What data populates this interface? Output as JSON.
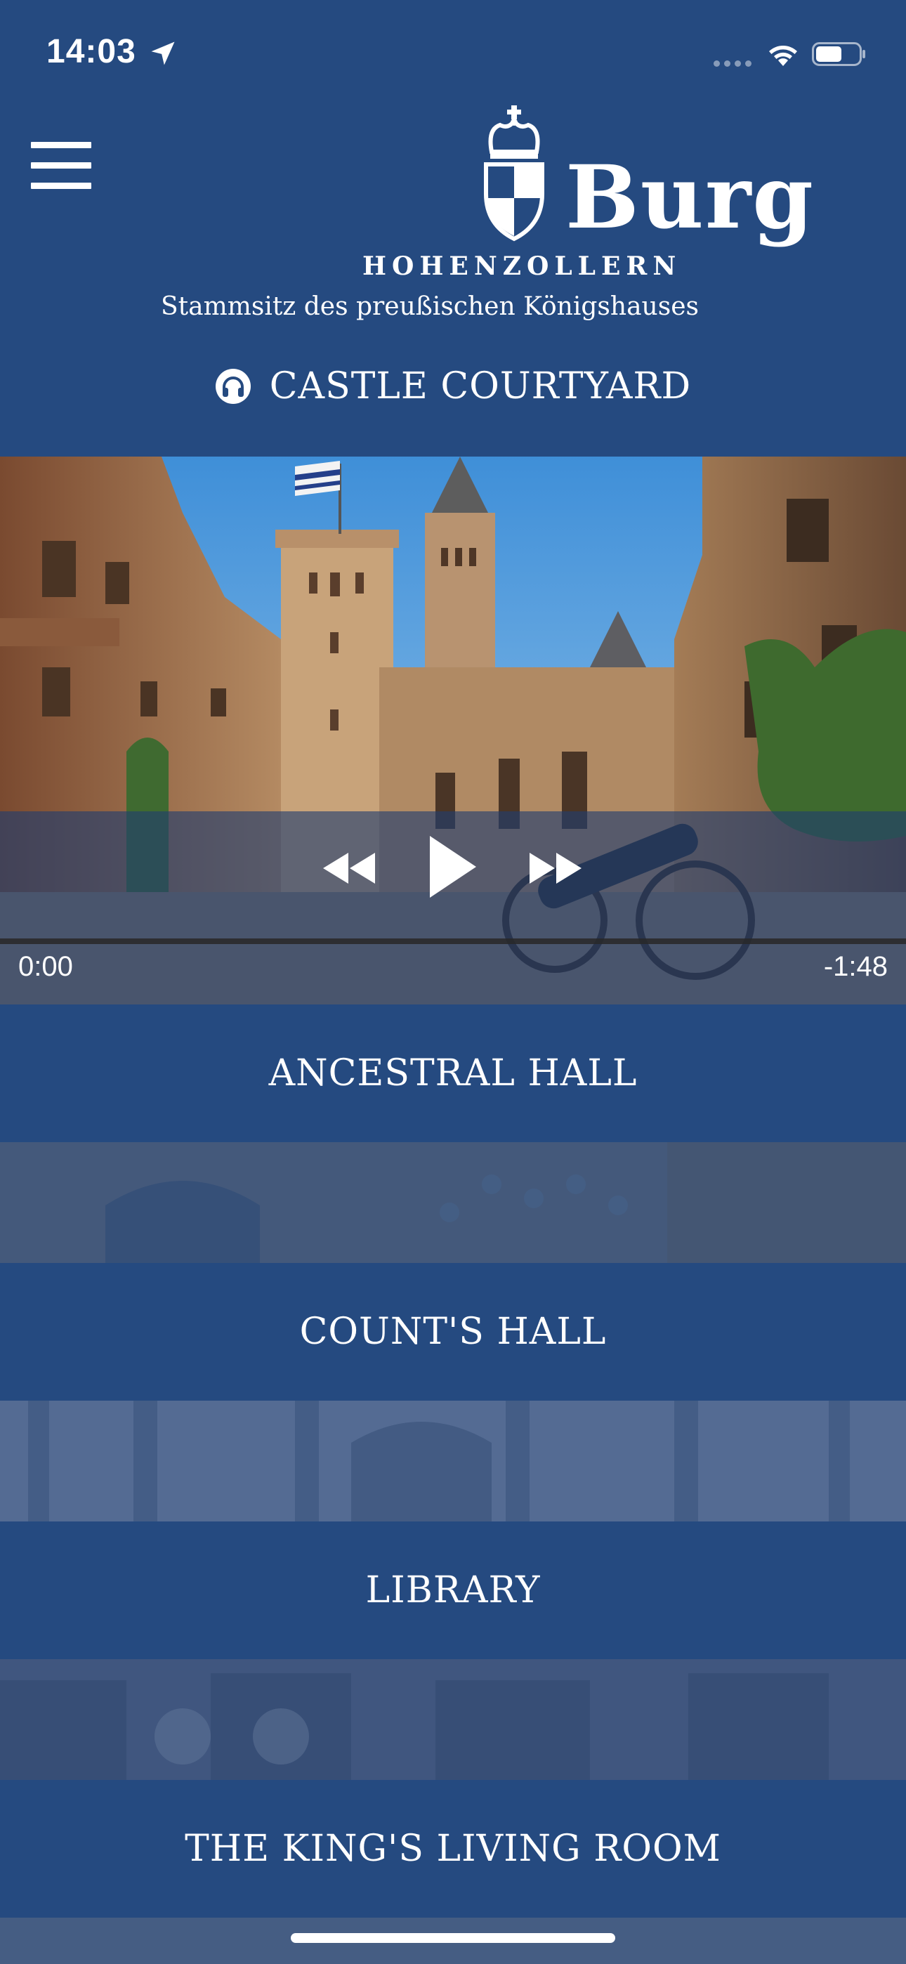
{
  "status_bar": {
    "time": "14:03"
  },
  "header": {
    "logo_word": "Burg",
    "logo_subword": "HOHENZOLLERN",
    "tagline": "Stammsitz des preußischen Königshauses"
  },
  "player": {
    "current_title": "CASTLE COURTYARD",
    "elapsed": "0:00",
    "remaining": "-1:48",
    "progress_fraction": 0.0
  },
  "rooms": [
    {
      "label": "ANCESTRAL HALL"
    },
    {
      "label": "COUNT'S HALL"
    },
    {
      "label": "LIBRARY"
    },
    {
      "label": "THE KING'S LIVING ROOM"
    }
  ],
  "colors": {
    "brand_blue": "#254a80",
    "text": "#ffffff"
  }
}
